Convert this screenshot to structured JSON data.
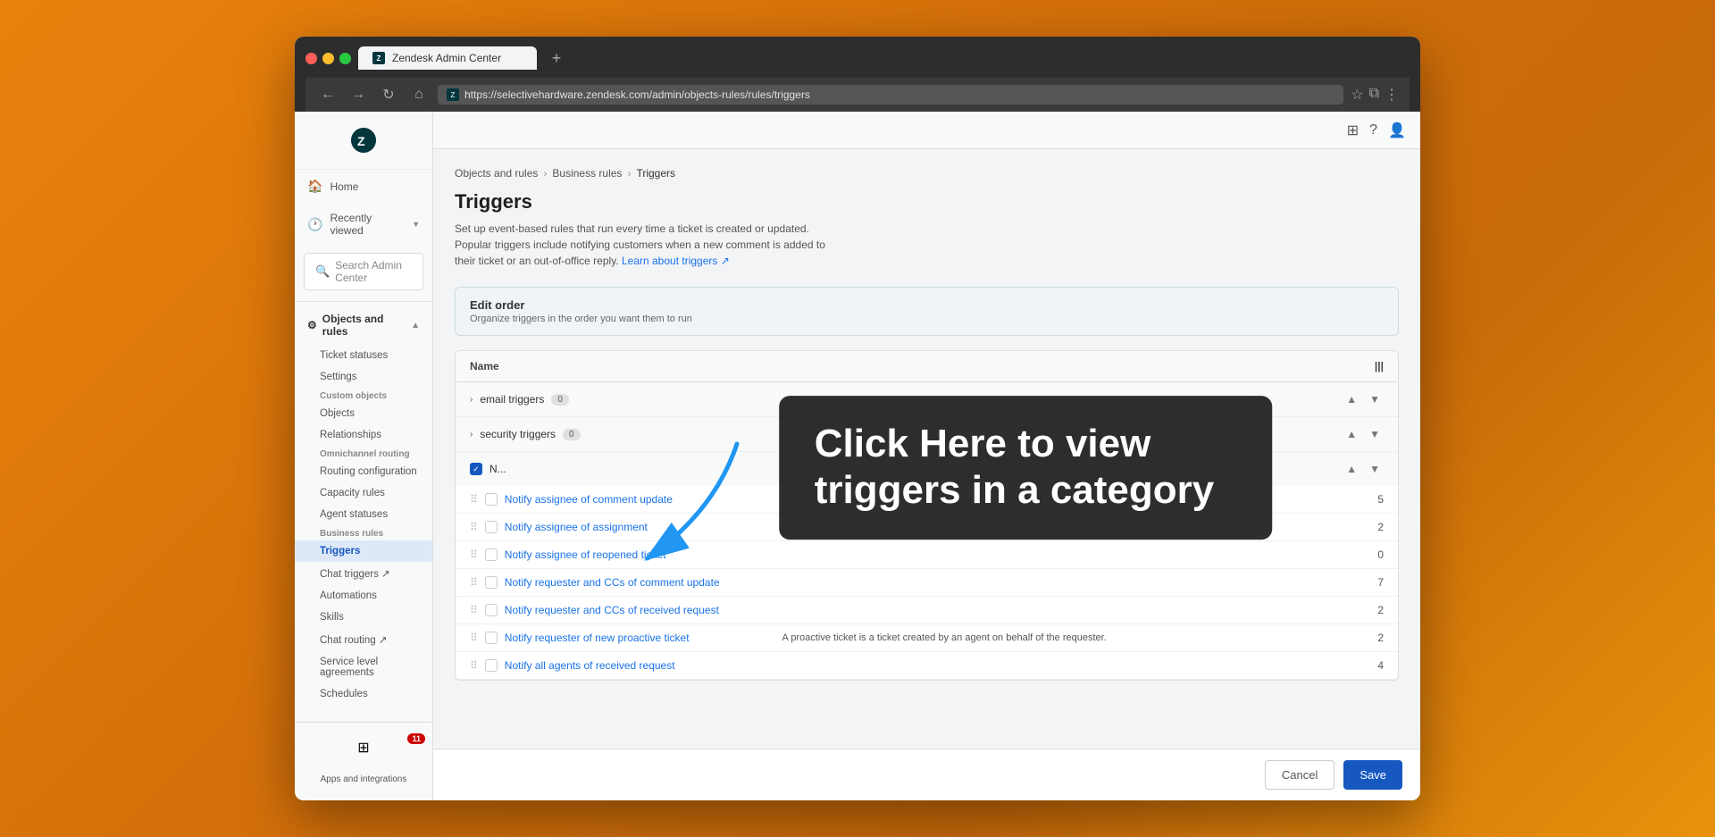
{
  "browser": {
    "tab_title": "Zendesk Admin Center",
    "url": "https://selectivehardware.zendesk.com/admin/objects-rules/rules/triggers",
    "tab_plus": "+",
    "nav": {
      "back": "←",
      "forward": "→",
      "refresh": "↻",
      "home": "⌂"
    },
    "star_icon": "☆",
    "ext_icon": "⧉",
    "menu_icon": "⋮"
  },
  "sidebar": {
    "logo_letter": "Z",
    "home_label": "Home",
    "recently_viewed_label": "Recently viewed",
    "search_placeholder": "Search Admin Center",
    "objects_and_rules_label": "Objects and rules",
    "sub_items": [
      {
        "label": "Ticket statuses",
        "active": false
      },
      {
        "label": "Settings",
        "active": false
      },
      {
        "label": "Objects",
        "active": false
      },
      {
        "label": "Relationships",
        "active": false
      },
      {
        "label": "Routing configuration",
        "active": false
      },
      {
        "label": "Capacity rules",
        "active": false
      },
      {
        "label": "Agent statuses",
        "active": false
      },
      {
        "label": "Triggers",
        "active": true
      },
      {
        "label": "Chat triggers ↗",
        "active": false
      },
      {
        "label": "Automations",
        "active": false
      },
      {
        "label": "Skills",
        "active": false
      },
      {
        "label": "Chat routing ↗",
        "active": false
      },
      {
        "label": "Service level agreements",
        "active": false
      },
      {
        "label": "Schedules",
        "active": false
      }
    ],
    "bottom_badge": "11",
    "apps_integrations_label": "Apps and integrations"
  },
  "top_bar": {
    "grid_icon": "⊞",
    "help_icon": "?",
    "user_icon": "👤"
  },
  "breadcrumb": {
    "items": [
      "Objects and rules",
      "Business rules",
      "Triggers"
    ]
  },
  "page": {
    "title": "Triggers",
    "description": "Set up event-based rules that run every time a ticket is created or updated. Popular triggers include notifying customers when a new comment is added to their ticket or an out-of-office reply.",
    "learn_link": "Learn about triggers ↗"
  },
  "edit_order": {
    "title": "Edit order",
    "description": "Organize triggers in the order you want them to run"
  },
  "table": {
    "col_name": "Name",
    "col_count_icon": "|||",
    "groups": [
      {
        "id": "email",
        "label": "email triggers",
        "count": "0",
        "expanded": false
      },
      {
        "id": "security",
        "label": "security triggers",
        "count": "0",
        "expanded": false
      },
      {
        "id": "notify",
        "label": "Notify triggers",
        "count": "",
        "expanded": true,
        "rows": [
          {
            "name": "Notify assignee of comment update",
            "description": "",
            "count": "5"
          },
          {
            "name": "Notify assignee of assignment",
            "description": "",
            "count": "2"
          },
          {
            "name": "Notify assignee of reopened ticket",
            "description": "",
            "count": "0"
          },
          {
            "name": "Notify requester and CCs of comment update",
            "description": "",
            "count": "7"
          },
          {
            "name": "Notify requester and CCs of received request",
            "description": "",
            "count": "2"
          },
          {
            "name": "Notify requester of new proactive ticket",
            "description": "A proactive ticket is a ticket created by an agent on behalf of the requester.",
            "count": "2"
          },
          {
            "name": "Notify all agents of received request",
            "description": "",
            "count": "4"
          }
        ]
      }
    ]
  },
  "bottom_bar": {
    "cancel_label": "Cancel",
    "save_label": "Save"
  },
  "overlay": {
    "text": "Click Here to view triggers in a category"
  },
  "section_headers": {
    "custom_objects": "Custom objects",
    "omnichannel_routing": "Omnichannel routing",
    "business_rules": "Business rules"
  }
}
